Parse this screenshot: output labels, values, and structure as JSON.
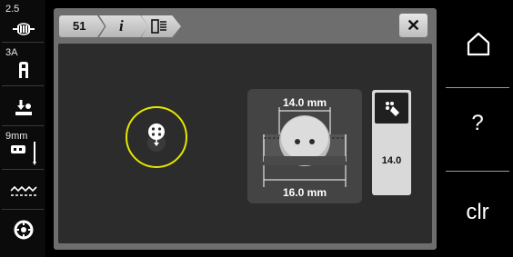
{
  "sidebar": {
    "items": [
      {
        "label": "2.5",
        "icon": "stitch-length-icon"
      },
      {
        "label": "3A",
        "icon": "presser-foot-icon"
      },
      {
        "label": "",
        "icon": "foot-pressure-icon"
      },
      {
        "label": "9mm",
        "icon": "needle-plate-icon"
      },
      {
        "label": "",
        "icon": "feed-dog-icon"
      },
      {
        "label": "",
        "icon": "bobbin-icon"
      }
    ]
  },
  "dialog": {
    "tabs": [
      {
        "label": "51"
      },
      {
        "label": "i"
      },
      {
        "label": "",
        "icon": "stitch-pattern-icon"
      }
    ],
    "close_label": "✕",
    "button_size": {
      "top_label": "14.0 mm",
      "bottom_label": "16.0 mm"
    },
    "panel": {
      "icon": "measure-button-icon",
      "value": "14.0"
    }
  },
  "rightbar": {
    "home_icon": "home-icon",
    "help_label": "?",
    "clear_label": "clr"
  },
  "colors": {
    "highlight": "#e6e600",
    "dialog_frame": "#6e6e6e",
    "dialog_bg": "#2c2c2c"
  }
}
